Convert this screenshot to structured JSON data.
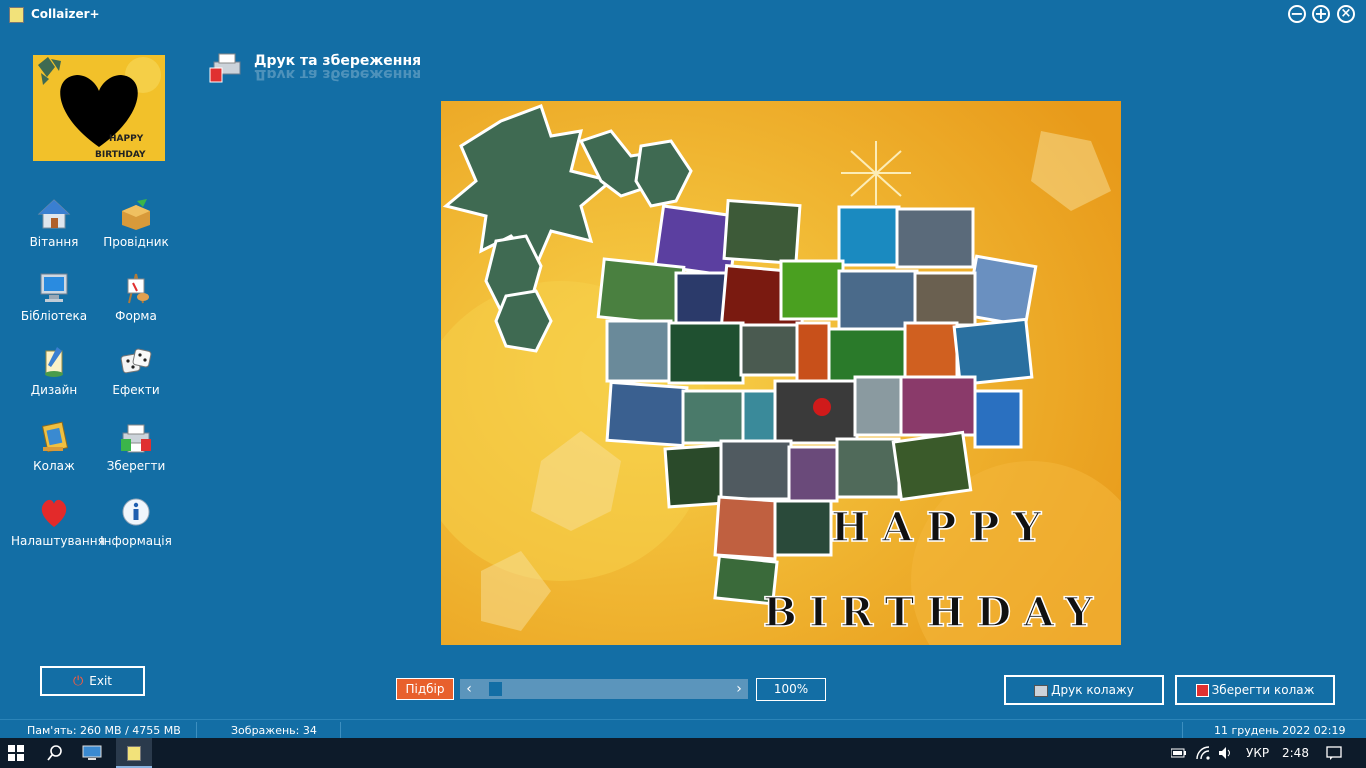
{
  "window": {
    "title": "Collaizer+",
    "controls": [
      "minimize-icon",
      "maximize-icon",
      "close-icon"
    ]
  },
  "sidebar": {
    "thumbnail_text": [
      "HAPPY",
      "BIRTHDAY"
    ],
    "items": [
      {
        "label": "Вітання",
        "icon": "home-icon"
      },
      {
        "label": "Провідник",
        "icon": "explorer-box-icon"
      },
      {
        "label": "Бібліотека",
        "icon": "monitor-icon"
      },
      {
        "label": "Форма",
        "icon": "shape-easel-icon"
      },
      {
        "label": "Дизайн",
        "icon": "design-brush-icon"
      },
      {
        "label": "Ефекти",
        "icon": "dice-icon"
      },
      {
        "label": "Колаж",
        "icon": "collage-icon"
      },
      {
        "label": "Зберегти",
        "icon": "save-print-icon"
      },
      {
        "label": "Налаштування",
        "icon": "heart-icon"
      },
      {
        "label": "Інформація",
        "icon": "info-icon"
      }
    ],
    "exit_label": "Exit"
  },
  "main": {
    "section_title": "Друк та збереження",
    "collage_text": {
      "line1": "HAPPY",
      "line2": "BIRTHDAY"
    },
    "fit_label": "Підбір",
    "zoom": "100%",
    "print_label": "Друк колажу",
    "save_label": "Зберегти колаж",
    "slider_position": 0.05
  },
  "status": {
    "memory": "Пам'ять: 260 MB / 4755 MB",
    "images": "Зображень: 34",
    "datetime": "11 грудень 2022   02:19"
  },
  "taskbar": {
    "lang": "УКР",
    "time": "2:48"
  },
  "colors": {
    "background": "#136ea5",
    "accent": "#e8602c",
    "canvas": "#f0b02a"
  }
}
